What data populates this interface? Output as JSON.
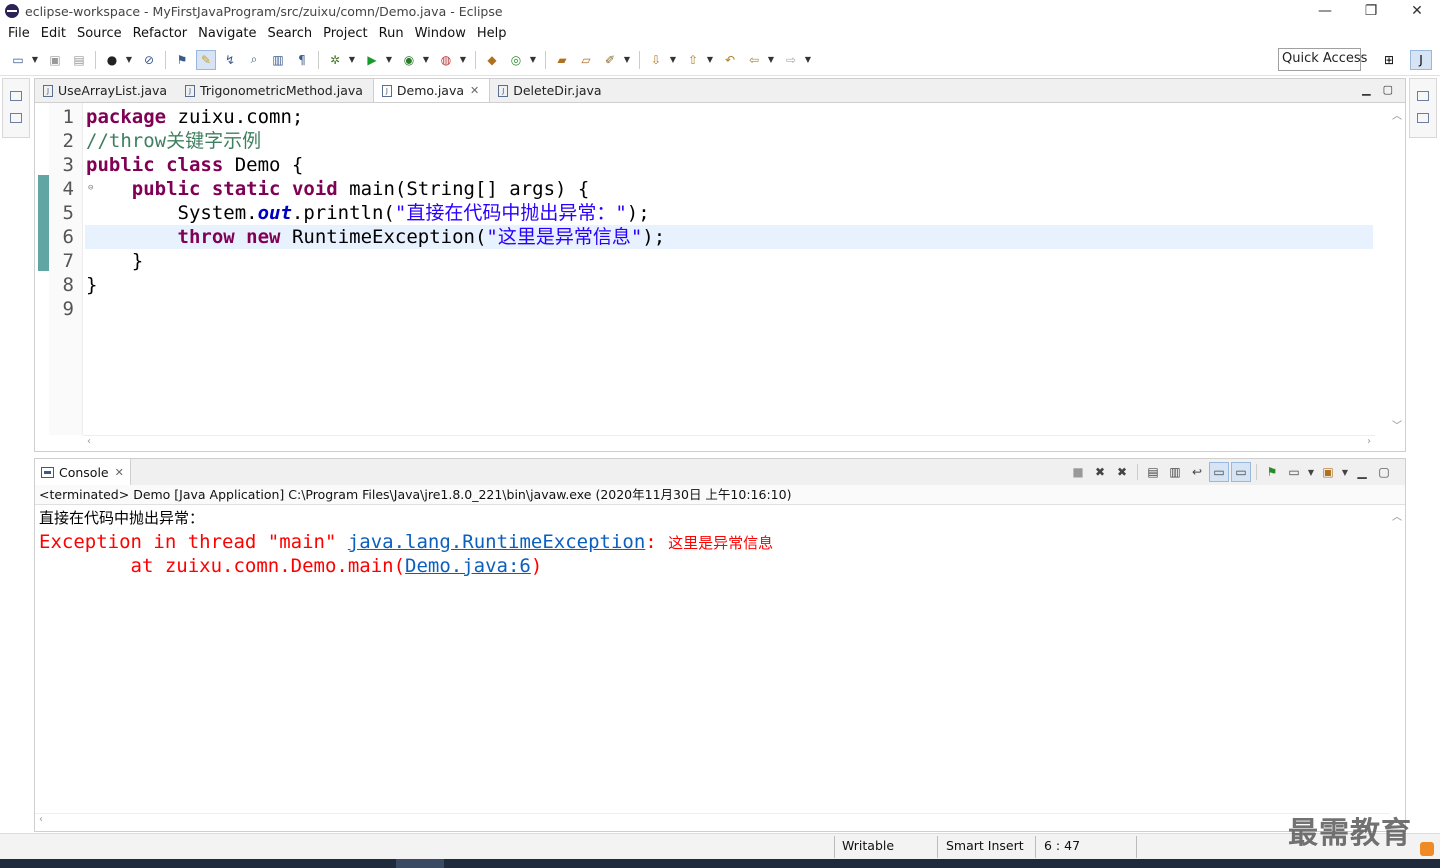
{
  "window": {
    "title": "eclipse-workspace - MyFirstJavaProgram/src/zuixu/comn/Demo.java - Eclipse",
    "min": "—",
    "restore": "❐",
    "close": "✕"
  },
  "menu": [
    "File",
    "Edit",
    "Source",
    "Refactor",
    "Navigate",
    "Search",
    "Project",
    "Run",
    "Window",
    "Help"
  ],
  "quick_access": "Quick Access",
  "editor": {
    "tabs": [
      {
        "label": "UseArrayList.java",
        "active": false
      },
      {
        "label": "TrigonometricMethod.java",
        "active": false
      },
      {
        "label": "Demo.java",
        "active": true
      },
      {
        "label": "DeleteDir.java",
        "active": false
      }
    ],
    "line_numbers": [
      "1",
      "2",
      "3",
      "4",
      "5",
      "6",
      "7",
      "8",
      "9"
    ],
    "code": {
      "l1_kw": "package",
      "l1_rest": " zuixu.comn;",
      "l2_comment": "//throw关键字示例",
      "l3_kw1": "public",
      "l3_kw2": "class",
      "l3_rest": " Demo {",
      "l4_indent": "    ",
      "l4_kw1": "public",
      "l4_kw2": "static",
      "l4_kw3": "void",
      "l4_rest": " main(String[] args) {",
      "l5_pre": "        System.",
      "l5_field": "out",
      "l5_mid": ".println(",
      "l5_str": "\"直接在代码中抛出异常：\"",
      "l5_end": ");",
      "l6_indent": "        ",
      "l6_kw1": "throw",
      "l6_kw2": "new",
      "l6_mid": " RuntimeException(",
      "l6_str": "\"这里是异常信息\"",
      "l6_end": ");",
      "l7": "    }",
      "l8": "}"
    }
  },
  "console": {
    "tab_label": "Console",
    "launch_info": "<terminated> Demo [Java Application] C:\\Program Files\\Java\\jre1.8.0_221\\bin\\javaw.exe (2020年11月30日 上午10:16:10)",
    "out_line1": "直接在代码中抛出异常：",
    "err_prefix": "Exception in thread \"main\" ",
    "err_link": "java.lang.RuntimeException",
    "err_colon": ": ",
    "err_msg": "这里是异常信息",
    "trace_prefix": "        at zuixu.comn.Demo.main(",
    "trace_link": "Demo.java:6",
    "trace_end": ")"
  },
  "status": {
    "writable": "Writable",
    "insert_mode": "Smart Insert",
    "position": "6 : 47"
  },
  "watermark": "最需教育",
  "colors": {
    "keyword": "#7f0055",
    "comment": "#3f7f5f",
    "string": "#2a00ff",
    "error": "#ff0000",
    "link": "#0b5fbf",
    "current_line": "#e8f2fe"
  }
}
